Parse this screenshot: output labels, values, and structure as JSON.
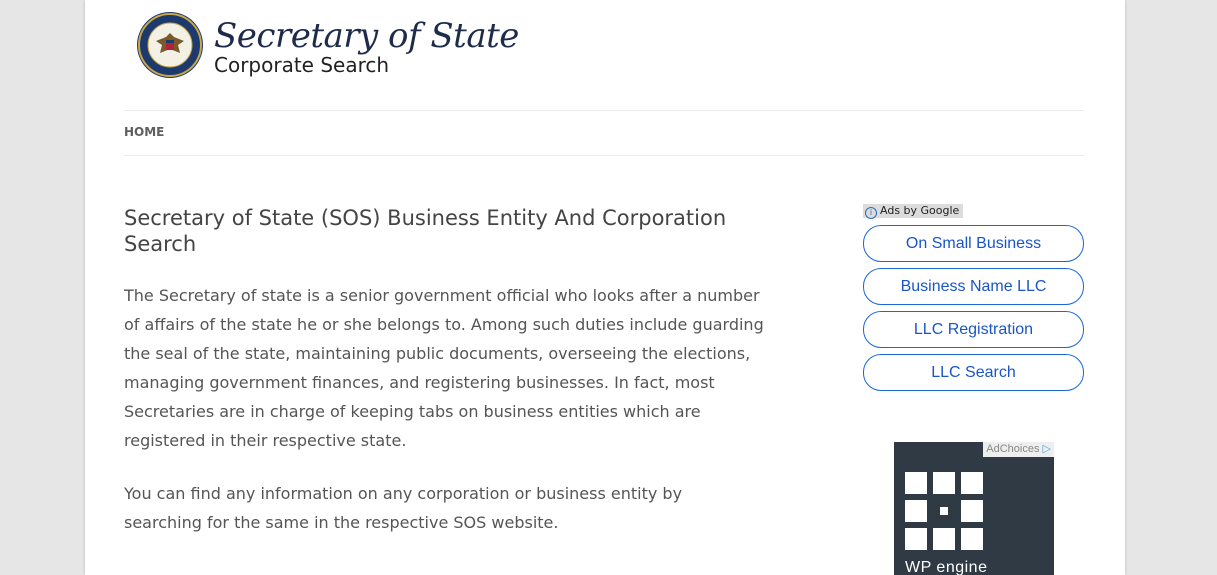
{
  "site": {
    "title": "Secretary of State",
    "subtitle": "Corporate Search"
  },
  "nav": {
    "home": "HOME"
  },
  "article": {
    "title": "Secretary of State (SOS) Business Entity And Corporation Search",
    "paragraphs": [
      "The Secretary of state is a senior government official who looks after a number of affairs of the state he or she belongs to. Among such duties include guarding the seal of the state, maintaining public documents, overseeing the elections, managing government finances, and registering businesses. In fact, most Secretaries are in charge of keeping tabs on business entities which are registered in their respective state.",
      "You can find any information on any corporation or business entity by searching for the same in the respective SOS website."
    ]
  },
  "sidebar": {
    "ads_by": "Ads by Google",
    "ad_links": [
      "On Small Business",
      "Business Name LLC",
      "LLC Registration",
      "LLC Search"
    ],
    "adchoices": "AdChoices",
    "banner_brand": "WP engine"
  },
  "colors": {
    "link_blue": "#1a55c8",
    "title_navy": "#1e2b4a",
    "background": "#e6e6e6"
  }
}
